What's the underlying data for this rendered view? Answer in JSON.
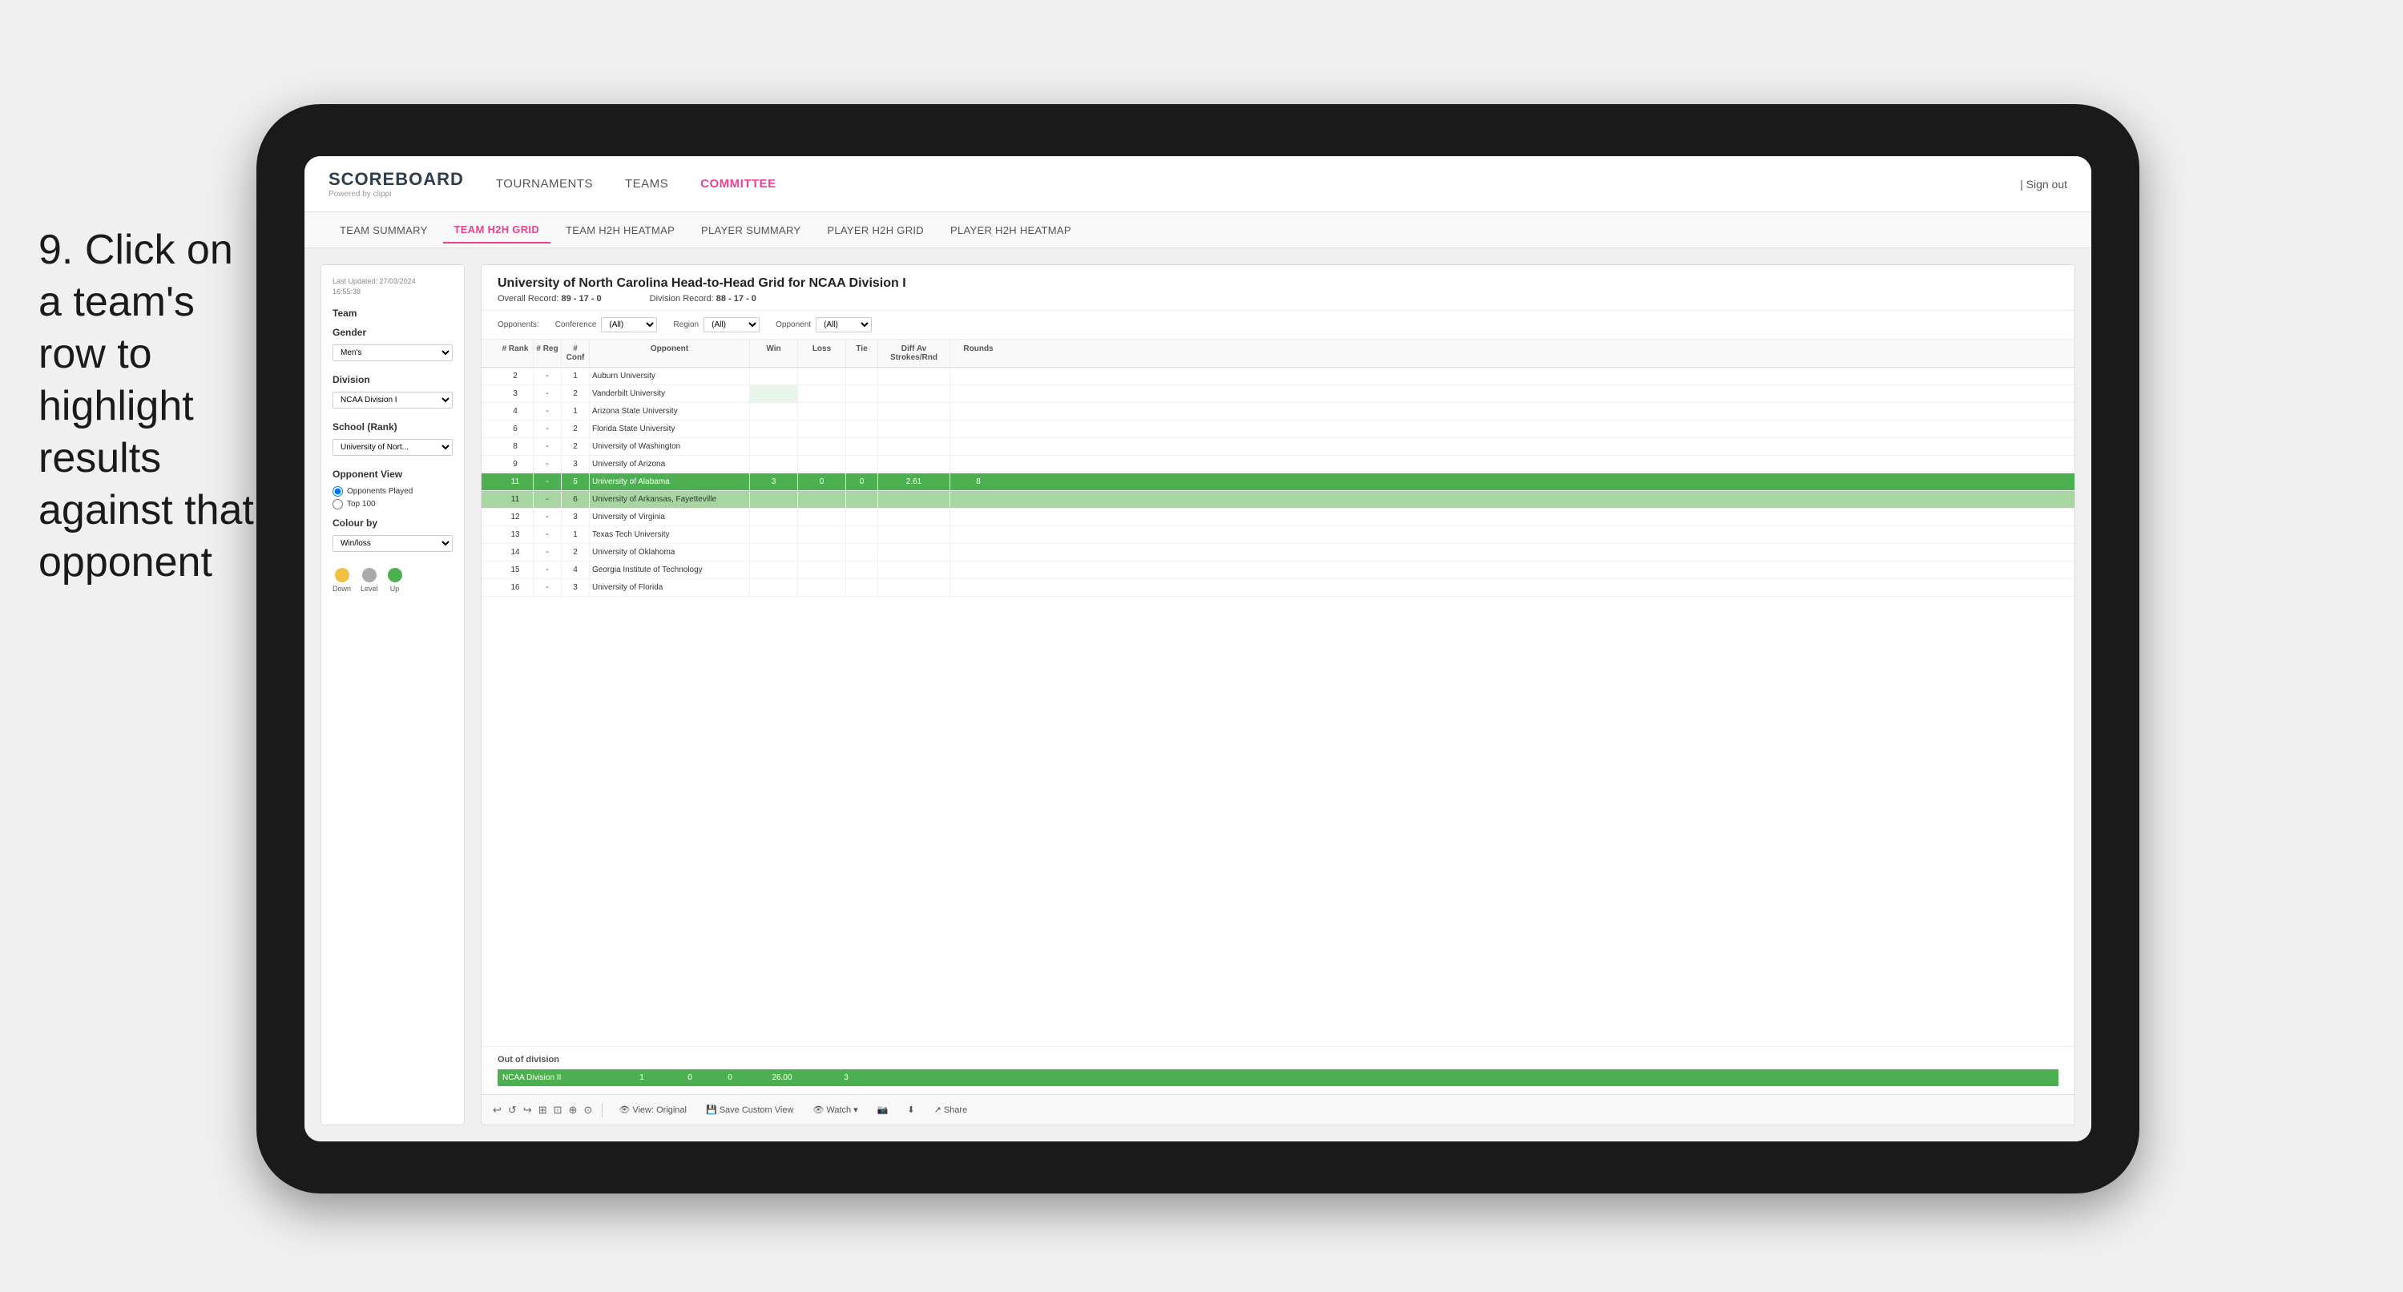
{
  "instruction": {
    "number": "9.",
    "text": "Click on a team's row to highlight results against that opponent"
  },
  "nav": {
    "logo": "SCOREBOARD",
    "logo_sub": "Powered by clippi",
    "links": [
      "TOURNAMENTS",
      "TEAMS",
      "COMMITTEE"
    ],
    "sign_out": "Sign out"
  },
  "sub_tabs": [
    {
      "label": "TEAM SUMMARY",
      "active": false
    },
    {
      "label": "TEAM H2H GRID",
      "active": true
    },
    {
      "label": "TEAM H2H HEATMAP",
      "active": false
    },
    {
      "label": "PLAYER SUMMARY",
      "active": false
    },
    {
      "label": "PLAYER H2H GRID",
      "active": false
    },
    {
      "label": "PLAYER H2H HEATMAP",
      "active": false
    }
  ],
  "sidebar": {
    "last_updated_label": "Last Updated: 27/03/2024",
    "last_updated_time": "16:55:38",
    "team_section": "Team",
    "gender_label": "Gender",
    "gender_value": "Men's",
    "division_label": "Division",
    "division_value": "NCAA Division I",
    "school_label": "School (Rank)",
    "school_value": "University of Nort...",
    "opponent_view_label": "Opponent View",
    "radio1": "Opponents Played",
    "radio2": "Top 100",
    "colour_by_label": "Colour by",
    "colour_by_value": "Win/loss",
    "legend_down": "Down",
    "legend_level": "Level",
    "legend_up": "Up"
  },
  "main": {
    "title": "University of North Carolina Head-to-Head Grid for NCAA Division I",
    "overall_record_label": "Overall Record:",
    "overall_record": "89 - 17 - 0",
    "division_record_label": "Division Record:",
    "division_record": "88 - 17 - 0",
    "filters": {
      "opponents_label": "Opponents:",
      "conference_label": "Conference",
      "conference_value": "(All)",
      "region_label": "Region",
      "region_value": "(All)",
      "opponent_label": "Opponent",
      "opponent_value": "(All)"
    },
    "col_headers": [
      "# Rank",
      "# Reg",
      "# Conf",
      "Opponent",
      "Win",
      "Loss",
      "Tie",
      "Diff Av Strokes/Rnd",
      "Rounds"
    ],
    "rows": [
      {
        "rank": "2",
        "reg": "-",
        "conf": "1",
        "opponent": "Auburn University",
        "win": "",
        "loss": "",
        "tie": "",
        "diff": "",
        "rounds": "",
        "highlight": false,
        "selected": false
      },
      {
        "rank": "3",
        "reg": "-",
        "conf": "2",
        "opponent": "Vanderbilt University",
        "win": "",
        "loss": "",
        "tie": "",
        "diff": "",
        "rounds": "",
        "highlight": false,
        "selected": false
      },
      {
        "rank": "4",
        "reg": "-",
        "conf": "1",
        "opponent": "Arizona State University",
        "win": "",
        "loss": "",
        "tie": "",
        "diff": "",
        "rounds": "",
        "highlight": false,
        "selected": false
      },
      {
        "rank": "6",
        "reg": "-",
        "conf": "2",
        "opponent": "Florida State University",
        "win": "",
        "loss": "",
        "tie": "",
        "diff": "",
        "rounds": "",
        "highlight": false,
        "selected": false
      },
      {
        "rank": "8",
        "reg": "-",
        "conf": "2",
        "opponent": "University of Washington",
        "win": "",
        "loss": "",
        "tie": "",
        "diff": "",
        "rounds": "",
        "highlight": false,
        "selected": false
      },
      {
        "rank": "9",
        "reg": "-",
        "conf": "3",
        "opponent": "University of Arizona",
        "win": "",
        "loss": "",
        "tie": "",
        "diff": "",
        "rounds": "",
        "highlight": false,
        "selected": false
      },
      {
        "rank": "11",
        "reg": "-",
        "conf": "5",
        "opponent": "University of Alabama",
        "win": "3",
        "loss": "0",
        "tie": "0",
        "diff": "2.61",
        "rounds": "8",
        "highlight": true,
        "selected": false
      },
      {
        "rank": "11",
        "reg": "-",
        "conf": "6",
        "opponent": "University of Arkansas, Fayetteville",
        "win": "",
        "loss": "",
        "tie": "",
        "diff": "",
        "rounds": "",
        "highlight": false,
        "selected": true
      },
      {
        "rank": "12",
        "reg": "-",
        "conf": "3",
        "opponent": "University of Virginia",
        "win": "",
        "loss": "",
        "tie": "",
        "diff": "",
        "rounds": "",
        "highlight": false,
        "selected": false
      },
      {
        "rank": "13",
        "reg": "-",
        "conf": "1",
        "opponent": "Texas Tech University",
        "win": "",
        "loss": "",
        "tie": "",
        "diff": "",
        "rounds": "",
        "highlight": false,
        "selected": false
      },
      {
        "rank": "14",
        "reg": "-",
        "conf": "2",
        "opponent": "University of Oklahoma",
        "win": "",
        "loss": "",
        "tie": "",
        "diff": "",
        "rounds": "",
        "highlight": false,
        "selected": false
      },
      {
        "rank": "15",
        "reg": "-",
        "conf": "4",
        "opponent": "Georgia Institute of Technology",
        "win": "",
        "loss": "",
        "tie": "",
        "diff": "",
        "rounds": "",
        "highlight": false,
        "selected": false
      },
      {
        "rank": "16",
        "reg": "-",
        "conf": "3",
        "opponent": "University of Florida",
        "win": "",
        "loss": "",
        "tie": "",
        "diff": "",
        "rounds": "",
        "highlight": false,
        "selected": false
      }
    ],
    "out_of_division_label": "Out of division",
    "out_row": {
      "label": "NCAA Division II",
      "win": "1",
      "loss": "0",
      "tie": "0",
      "diff": "26.00",
      "rounds": "3"
    }
  },
  "toolbar": {
    "view_label": "View: Original",
    "save_custom_label": "Save Custom View",
    "watch_label": "Watch",
    "share_label": "Share"
  },
  "colors": {
    "highlight_green": "#4caf50",
    "selected_green": "#a8d5a2",
    "light_green": "#e8f5e9",
    "accent_pink": "#e84393",
    "legend_down": "#f0c040",
    "legend_level": "#aaaaaa",
    "legend_up": "#4caf50"
  }
}
